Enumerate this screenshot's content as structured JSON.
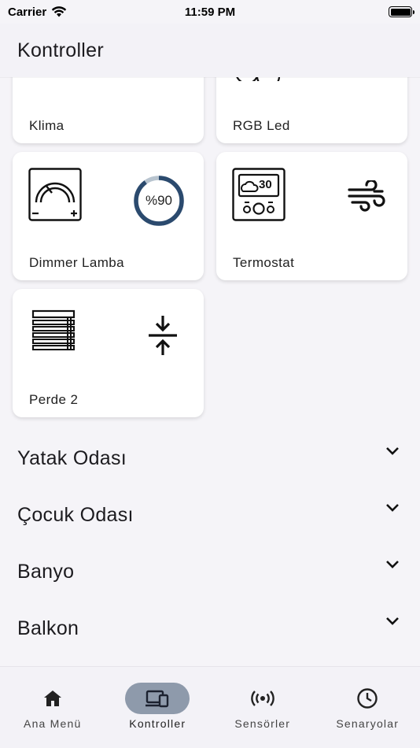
{
  "status": {
    "carrier": "Carrier",
    "time": "11:59 PM"
  },
  "app_bar": {
    "title": "Kontroller"
  },
  "devices": [
    {
      "label": "Klima"
    },
    {
      "label": "RGB Led"
    },
    {
      "label": "Dimmer Lamba",
      "level_text": "%90",
      "level": 0.9
    },
    {
      "label": "Termostat",
      "temperature": "30"
    },
    {
      "label": "Perde 2"
    }
  ],
  "rooms": [
    {
      "title": "Yatak Odası"
    },
    {
      "title": "Çocuk Odası"
    },
    {
      "title": "Banyo"
    },
    {
      "title": "Balkon"
    }
  ],
  "nav": [
    {
      "label": "Ana Menü",
      "icon": "home-icon"
    },
    {
      "label": "Kontroller",
      "icon": "devices-icon",
      "active": true
    },
    {
      "label": "Sensörler",
      "icon": "sensors-icon"
    },
    {
      "label": "Senaryolar",
      "icon": "clock-icon"
    }
  ],
  "colors": {
    "accent_ring": "#2b4a6e",
    "ring_track": "#b8c4cf",
    "nav_active": "#8e9aab",
    "rgb_purple": "#8a3be0"
  }
}
